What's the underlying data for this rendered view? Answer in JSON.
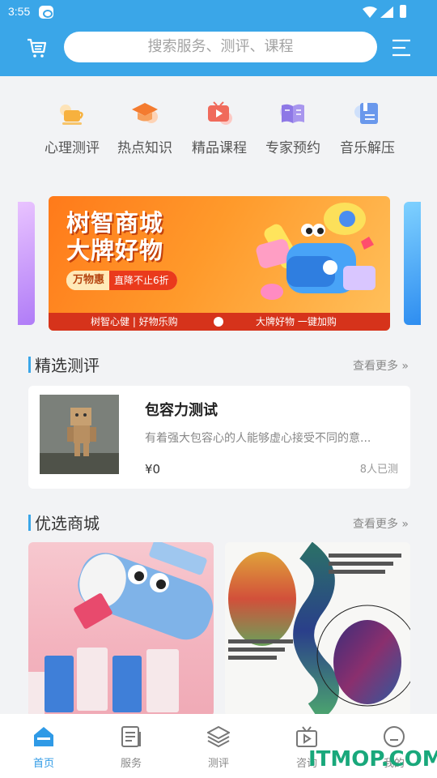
{
  "status_bar": {
    "time": "3:55"
  },
  "header": {
    "search_placeholder": "搜索服务、测评、课程"
  },
  "nav": {
    "items": [
      {
        "label": "心理测评",
        "icon": "coffee-cup-icon"
      },
      {
        "label": "热点知识",
        "icon": "graduation-cap-icon"
      },
      {
        "label": "精品课程",
        "icon": "video-play-icon"
      },
      {
        "label": "专家预约",
        "icon": "open-book-icon"
      },
      {
        "label": "音乐解压",
        "icon": "notebook-icon"
      }
    ]
  },
  "banner": {
    "title_line1": "树智商城",
    "title_line2": "大牌好物",
    "pill_brand": "万物惠",
    "pill_text": "直降不止6折",
    "footer_left": "树智心健 | 好物乐购",
    "footer_right": "大牌好物 一键加购"
  },
  "featured_tests": {
    "title": "精选测评",
    "more": "查看更多",
    "items": [
      {
        "title": "包容力测试",
        "desc": "有着强大包容心的人能够虚心接受不同的意...",
        "price": "¥0",
        "count": "8人已测"
      }
    ]
  },
  "shop": {
    "title": "优选商城",
    "more": "查看更多"
  },
  "tabbar": {
    "items": [
      {
        "label": "首页",
        "icon": "home-icon",
        "active": true
      },
      {
        "label": "服务",
        "icon": "document-icon",
        "active": false
      },
      {
        "label": "测评",
        "icon": "layers-icon",
        "active": false
      },
      {
        "label": "咨询",
        "icon": "tv-play-icon",
        "active": false
      },
      {
        "label": "我的",
        "icon": "user-icon",
        "active": false
      }
    ]
  },
  "watermark": "ITMOP.COM",
  "colors": {
    "primary": "#3aa6e8",
    "tab_active": "#2f9ae6",
    "watermark": "#19a87b"
  }
}
